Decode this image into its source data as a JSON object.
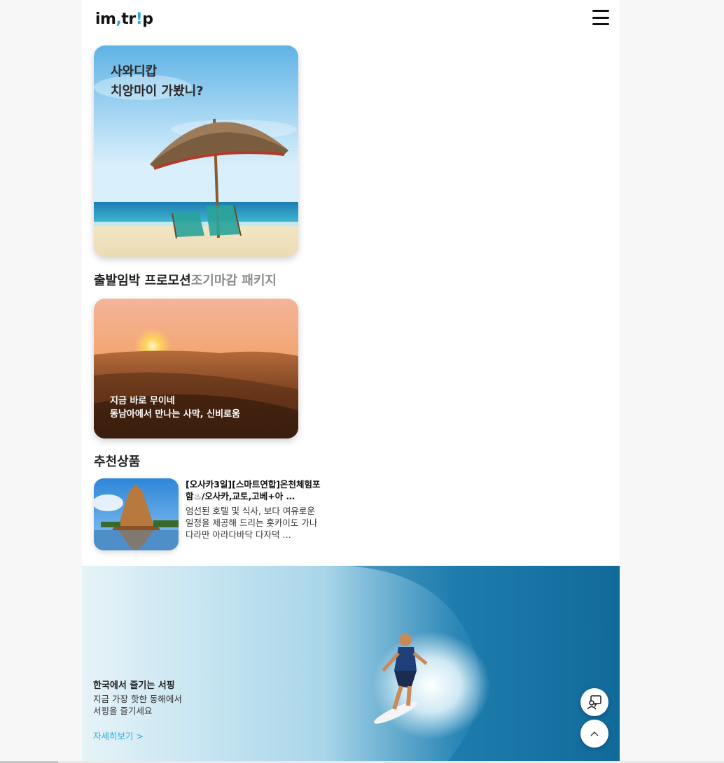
{
  "header": {
    "logo_part1": "im",
    "logo_comma": ",",
    "logo_part2": "tr",
    "logo_excl": "!",
    "logo_part3": "p"
  },
  "hero": {
    "title_line1": "사와디캅",
    "title_line2": "치앙마이 가봤니?"
  },
  "tabs": {
    "active": "출발임박 프로모션",
    "inactive": "조기마감 패키지"
  },
  "promo": {
    "line1": "지금 바로 무이네",
    "line2": "동남아에서 만나는 사막, 신비로움"
  },
  "recommend": {
    "title": "추천상품",
    "item": {
      "name": "[오사카3일][스마트연합]온천체험포함♨/오사카,교토,고베+아 …",
      "desc": "엄선된 호텔 및 식사, 보다 여유로운 일정을 제공해 드리는 홋카이도 가나다라만 아라다바닥 다자덕 …"
    }
  },
  "surf": {
    "title": "한국에서 즐기는 서핑",
    "desc_line1": "지금 가장 핫한 동해에서",
    "desc_line2": "서핑을 즐기세요",
    "link": "자세히보기 >"
  },
  "colors": {
    "accent": "#2aa9e0",
    "text": "#222222",
    "muted": "#8a8a8a"
  },
  "icons": {
    "menu": "hamburger-menu-icon",
    "chat": "chat-support-icon",
    "top": "chevron-up-icon"
  }
}
